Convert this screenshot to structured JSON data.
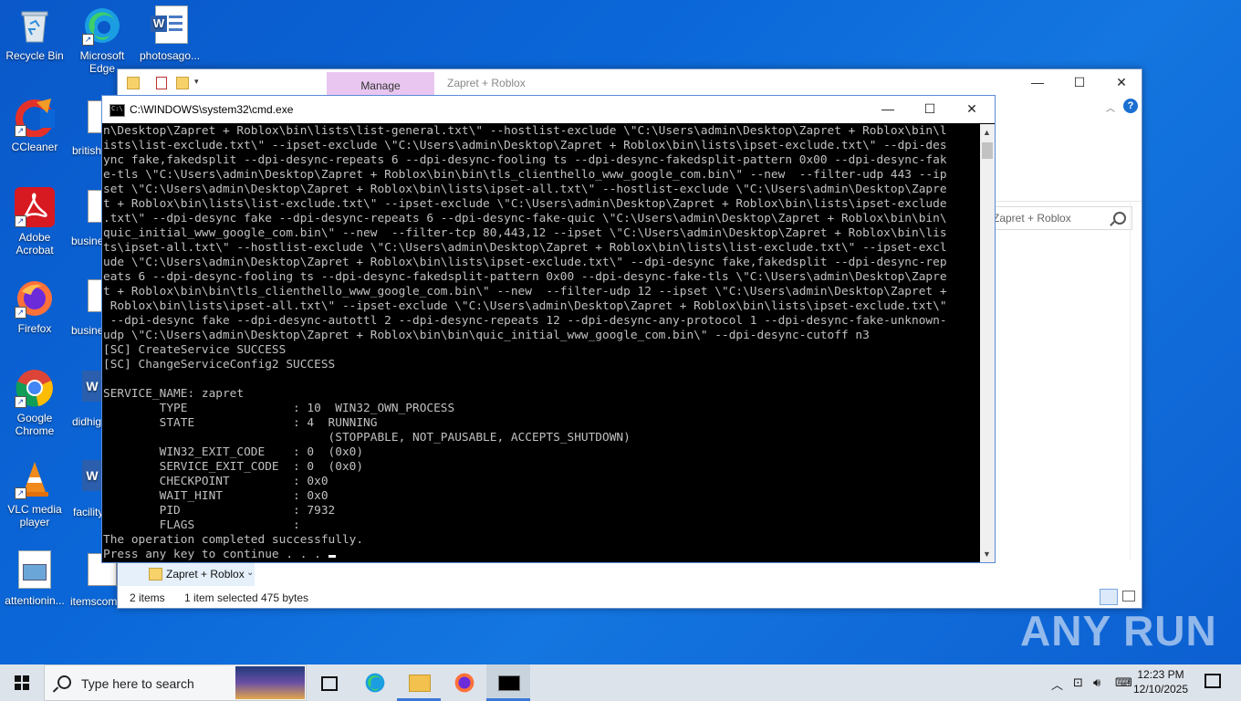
{
  "desktop": {
    "icons": [
      {
        "label": "Recycle Bin"
      },
      {
        "label": "Microsoft Edge"
      },
      {
        "label": "photosago..."
      },
      {
        "label": "CCleaner"
      },
      {
        "label": "Adobe Acrobat"
      },
      {
        "label": "Firefox"
      },
      {
        "label": "Google Chrome"
      },
      {
        "label": "VLC media player"
      },
      {
        "label": "attentionin..."
      }
    ],
    "partial_labels": [
      "british",
      "busine",
      "busine",
      "didhig",
      "facility",
      "itemscom"
    ]
  },
  "explorer": {
    "manage_tab": "Manage",
    "title": "Zapret + Roblox",
    "search_placeholder": "Zapret + Roblox",
    "folder_item": "Zapret + Roblox",
    "status": {
      "items": "2 items",
      "selected": "1 item selected",
      "size": "475 bytes"
    }
  },
  "cmd": {
    "title": "C:\\WINDOWS\\system32\\cmd.exe",
    "lines": [
      "n\\Desktop\\Zapret + Roblox\\bin\\lists\\list-general.txt\\\" --hostlist-exclude \\\"C:\\Users\\admin\\Desktop\\Zapret + Roblox\\bin\\l",
      "ists\\list-exclude.txt\\\" --ipset-exclude \\\"C:\\Users\\admin\\Desktop\\Zapret + Roblox\\bin\\lists\\ipset-exclude.txt\\\" --dpi-des",
      "ync fake,fakedsplit --dpi-desync-repeats 6 --dpi-desync-fooling ts --dpi-desync-fakedsplit-pattern 0x00 --dpi-desync-fak",
      "e-tls \\\"C:\\Users\\admin\\Desktop\\Zapret + Roblox\\bin\\bin\\tls_clienthello_www_google_com.bin\\\" --new  --filter-udp 443 --ip",
      "set \\\"C:\\Users\\admin\\Desktop\\Zapret + Roblox\\bin\\lists\\ipset-all.txt\\\" --hostlist-exclude \\\"C:\\Users\\admin\\Desktop\\Zapre",
      "t + Roblox\\bin\\lists\\list-exclude.txt\\\" --ipset-exclude \\\"C:\\Users\\admin\\Desktop\\Zapret + Roblox\\bin\\lists\\ipset-exclude",
      ".txt\\\" --dpi-desync fake --dpi-desync-repeats 6 --dpi-desync-fake-quic \\\"C:\\Users\\admin\\Desktop\\Zapret + Roblox\\bin\\bin\\",
      "quic_initial_www_google_com.bin\\\" --new  --filter-tcp 80,443,12 --ipset \\\"C:\\Users\\admin\\Desktop\\Zapret + Roblox\\bin\\lis",
      "ts\\ipset-all.txt\\\" --hostlist-exclude \\\"C:\\Users\\admin\\Desktop\\Zapret + Roblox\\bin\\lists\\list-exclude.txt\\\" --ipset-excl",
      "ude \\\"C:\\Users\\admin\\Desktop\\Zapret + Roblox\\bin\\lists\\ipset-exclude.txt\\\" --dpi-desync fake,fakedsplit --dpi-desync-rep",
      "eats 6 --dpi-desync-fooling ts --dpi-desync-fakedsplit-pattern 0x00 --dpi-desync-fake-tls \\\"C:\\Users\\admin\\Desktop\\Zapre",
      "t + Roblox\\bin\\bin\\tls_clienthello_www_google_com.bin\\\" --new  --filter-udp 12 --ipset \\\"C:\\Users\\admin\\Desktop\\Zapret +",
      " Roblox\\bin\\lists\\ipset-all.txt\\\" --ipset-exclude \\\"C:\\Users\\admin\\Desktop\\Zapret + Roblox\\bin\\lists\\ipset-exclude.txt\\\"",
      " --dpi-desync fake --dpi-desync-autottl 2 --dpi-desync-repeats 12 --dpi-desync-any-protocol 1 --dpi-desync-fake-unknown-",
      "udp \\\"C:\\Users\\admin\\Desktop\\Zapret + Roblox\\bin\\bin\\quic_initial_www_google_com.bin\\\" --dpi-desync-cutoff n3",
      "[SC] CreateService SUCCESS",
      "[SC] ChangeServiceConfig2 SUCCESS",
      "",
      "SERVICE_NAME: zapret",
      "        TYPE               : 10  WIN32_OWN_PROCESS",
      "        STATE              : 4  RUNNING",
      "                                (STOPPABLE, NOT_PAUSABLE, ACCEPTS_SHUTDOWN)",
      "        WIN32_EXIT_CODE    : 0  (0x0)",
      "        SERVICE_EXIT_CODE  : 0  (0x0)",
      "        CHECKPOINT         : 0x0",
      "        WAIT_HINT          : 0x0",
      "        PID                : 7932",
      "        FLAGS              :",
      "The operation completed successfully.",
      "Press any key to continue . . . "
    ]
  },
  "taskbar": {
    "search_placeholder": "Type here to search",
    "time": "12:23 PM",
    "date": "12/10/2025"
  },
  "watermark": "ANY RUN"
}
